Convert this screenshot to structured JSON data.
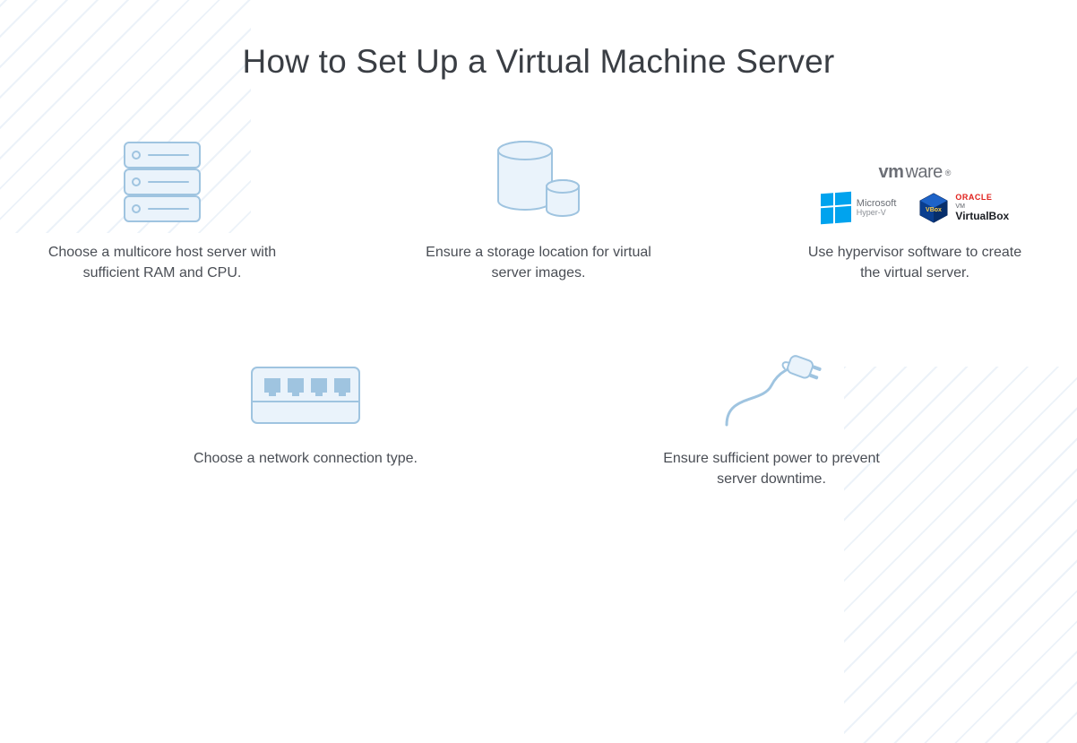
{
  "title": "How to Set Up a Virtual Machine Server",
  "steps": {
    "host_server": "Choose a multicore host server with sufficient RAM and CPU.",
    "storage": "Ensure a storage location for virtual server images.",
    "hypervisor": "Use hypervisor software to create the virtual server.",
    "network": "Choose a network connection type.",
    "power": "Ensure sufficient power to prevent server downtime."
  },
  "logos": {
    "vmware_vm": "vm",
    "vmware_ware": "ware",
    "vmware_reg": "®",
    "microsoft": "Microsoft",
    "hyperv": "Hyper-V",
    "oracle": "ORACLE",
    "oracle_vm": "VM",
    "virtualbox": "VirtualBox"
  }
}
